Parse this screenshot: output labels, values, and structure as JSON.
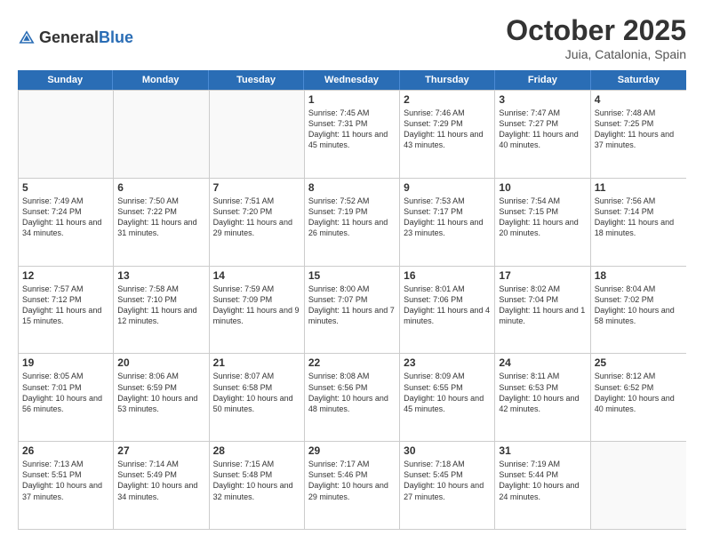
{
  "header": {
    "logo_general": "General",
    "logo_blue": "Blue",
    "month": "October 2025",
    "location": "Juia, Catalonia, Spain"
  },
  "weekdays": [
    "Sunday",
    "Monday",
    "Tuesday",
    "Wednesday",
    "Thursday",
    "Friday",
    "Saturday"
  ],
  "rows": [
    [
      {
        "day": "",
        "info": ""
      },
      {
        "day": "",
        "info": ""
      },
      {
        "day": "",
        "info": ""
      },
      {
        "day": "1",
        "info": "Sunrise: 7:45 AM\nSunset: 7:31 PM\nDaylight: 11 hours and 45 minutes."
      },
      {
        "day": "2",
        "info": "Sunrise: 7:46 AM\nSunset: 7:29 PM\nDaylight: 11 hours and 43 minutes."
      },
      {
        "day": "3",
        "info": "Sunrise: 7:47 AM\nSunset: 7:27 PM\nDaylight: 11 hours and 40 minutes."
      },
      {
        "day": "4",
        "info": "Sunrise: 7:48 AM\nSunset: 7:25 PM\nDaylight: 11 hours and 37 minutes."
      }
    ],
    [
      {
        "day": "5",
        "info": "Sunrise: 7:49 AM\nSunset: 7:24 PM\nDaylight: 11 hours and 34 minutes."
      },
      {
        "day": "6",
        "info": "Sunrise: 7:50 AM\nSunset: 7:22 PM\nDaylight: 11 hours and 31 minutes."
      },
      {
        "day": "7",
        "info": "Sunrise: 7:51 AM\nSunset: 7:20 PM\nDaylight: 11 hours and 29 minutes."
      },
      {
        "day": "8",
        "info": "Sunrise: 7:52 AM\nSunset: 7:19 PM\nDaylight: 11 hours and 26 minutes."
      },
      {
        "day": "9",
        "info": "Sunrise: 7:53 AM\nSunset: 7:17 PM\nDaylight: 11 hours and 23 minutes."
      },
      {
        "day": "10",
        "info": "Sunrise: 7:54 AM\nSunset: 7:15 PM\nDaylight: 11 hours and 20 minutes."
      },
      {
        "day": "11",
        "info": "Sunrise: 7:56 AM\nSunset: 7:14 PM\nDaylight: 11 hours and 18 minutes."
      }
    ],
    [
      {
        "day": "12",
        "info": "Sunrise: 7:57 AM\nSunset: 7:12 PM\nDaylight: 11 hours and 15 minutes."
      },
      {
        "day": "13",
        "info": "Sunrise: 7:58 AM\nSunset: 7:10 PM\nDaylight: 11 hours and 12 minutes."
      },
      {
        "day": "14",
        "info": "Sunrise: 7:59 AM\nSunset: 7:09 PM\nDaylight: 11 hours and 9 minutes."
      },
      {
        "day": "15",
        "info": "Sunrise: 8:00 AM\nSunset: 7:07 PM\nDaylight: 11 hours and 7 minutes."
      },
      {
        "day": "16",
        "info": "Sunrise: 8:01 AM\nSunset: 7:06 PM\nDaylight: 11 hours and 4 minutes."
      },
      {
        "day": "17",
        "info": "Sunrise: 8:02 AM\nSunset: 7:04 PM\nDaylight: 11 hours and 1 minute."
      },
      {
        "day": "18",
        "info": "Sunrise: 8:04 AM\nSunset: 7:02 PM\nDaylight: 10 hours and 58 minutes."
      }
    ],
    [
      {
        "day": "19",
        "info": "Sunrise: 8:05 AM\nSunset: 7:01 PM\nDaylight: 10 hours and 56 minutes."
      },
      {
        "day": "20",
        "info": "Sunrise: 8:06 AM\nSunset: 6:59 PM\nDaylight: 10 hours and 53 minutes."
      },
      {
        "day": "21",
        "info": "Sunrise: 8:07 AM\nSunset: 6:58 PM\nDaylight: 10 hours and 50 minutes."
      },
      {
        "day": "22",
        "info": "Sunrise: 8:08 AM\nSunset: 6:56 PM\nDaylight: 10 hours and 48 minutes."
      },
      {
        "day": "23",
        "info": "Sunrise: 8:09 AM\nSunset: 6:55 PM\nDaylight: 10 hours and 45 minutes."
      },
      {
        "day": "24",
        "info": "Sunrise: 8:11 AM\nSunset: 6:53 PM\nDaylight: 10 hours and 42 minutes."
      },
      {
        "day": "25",
        "info": "Sunrise: 8:12 AM\nSunset: 6:52 PM\nDaylight: 10 hours and 40 minutes."
      }
    ],
    [
      {
        "day": "26",
        "info": "Sunrise: 7:13 AM\nSunset: 5:51 PM\nDaylight: 10 hours and 37 minutes."
      },
      {
        "day": "27",
        "info": "Sunrise: 7:14 AM\nSunset: 5:49 PM\nDaylight: 10 hours and 34 minutes."
      },
      {
        "day": "28",
        "info": "Sunrise: 7:15 AM\nSunset: 5:48 PM\nDaylight: 10 hours and 32 minutes."
      },
      {
        "day": "29",
        "info": "Sunrise: 7:17 AM\nSunset: 5:46 PM\nDaylight: 10 hours and 29 minutes."
      },
      {
        "day": "30",
        "info": "Sunrise: 7:18 AM\nSunset: 5:45 PM\nDaylight: 10 hours and 27 minutes."
      },
      {
        "day": "31",
        "info": "Sunrise: 7:19 AM\nSunset: 5:44 PM\nDaylight: 10 hours and 24 minutes."
      },
      {
        "day": "",
        "info": ""
      }
    ]
  ]
}
